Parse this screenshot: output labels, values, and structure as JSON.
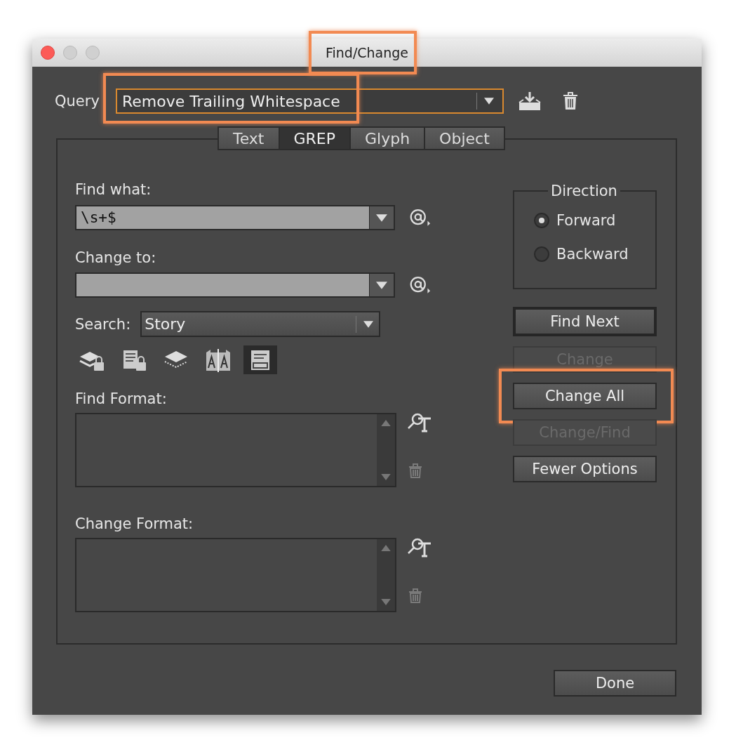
{
  "window": {
    "title": "Find/Change",
    "highlighted": true
  },
  "query": {
    "label": "Query",
    "value": "Remove Trailing Whitespace",
    "highlighted": true
  },
  "tabs": [
    {
      "label": "Text",
      "selected": false
    },
    {
      "label": "GREP",
      "selected": true
    },
    {
      "label": "Glyph",
      "selected": false
    },
    {
      "label": "Object",
      "selected": false
    }
  ],
  "find_what": {
    "label": "Find what:",
    "value": "\\s+$"
  },
  "change_to": {
    "label": "Change to:"
  },
  "search": {
    "label": "Search:",
    "value": "Story"
  },
  "search_options": [
    {
      "kind": "locked-layers",
      "selected": false
    },
    {
      "kind": "locked-stories",
      "selected": false
    },
    {
      "kind": "hidden-layers",
      "selected": false
    },
    {
      "kind": "master-pages",
      "selected": false
    },
    {
      "kind": "footnotes",
      "selected": true
    }
  ],
  "find_format": {
    "label": "Find Format:"
  },
  "change_format": {
    "label": "Change Format:"
  },
  "direction": {
    "label": "Direction",
    "options": [
      {
        "label": "Forward",
        "selected": true
      },
      {
        "label": "Backward",
        "selected": false
      }
    ]
  },
  "buttons": [
    {
      "label": "Find Next",
      "default": true,
      "disabled": false,
      "highlighted": false
    },
    {
      "label": "Change",
      "default": false,
      "disabled": true,
      "highlighted": false
    },
    {
      "label": "Change All",
      "default": false,
      "disabled": false,
      "highlighted": true
    },
    {
      "label": "Change/Find",
      "default": false,
      "disabled": true,
      "highlighted": false
    },
    {
      "label": "Fewer Options",
      "default": false,
      "disabled": false,
      "highlighted": false
    }
  ],
  "done": {
    "label": "Done"
  }
}
